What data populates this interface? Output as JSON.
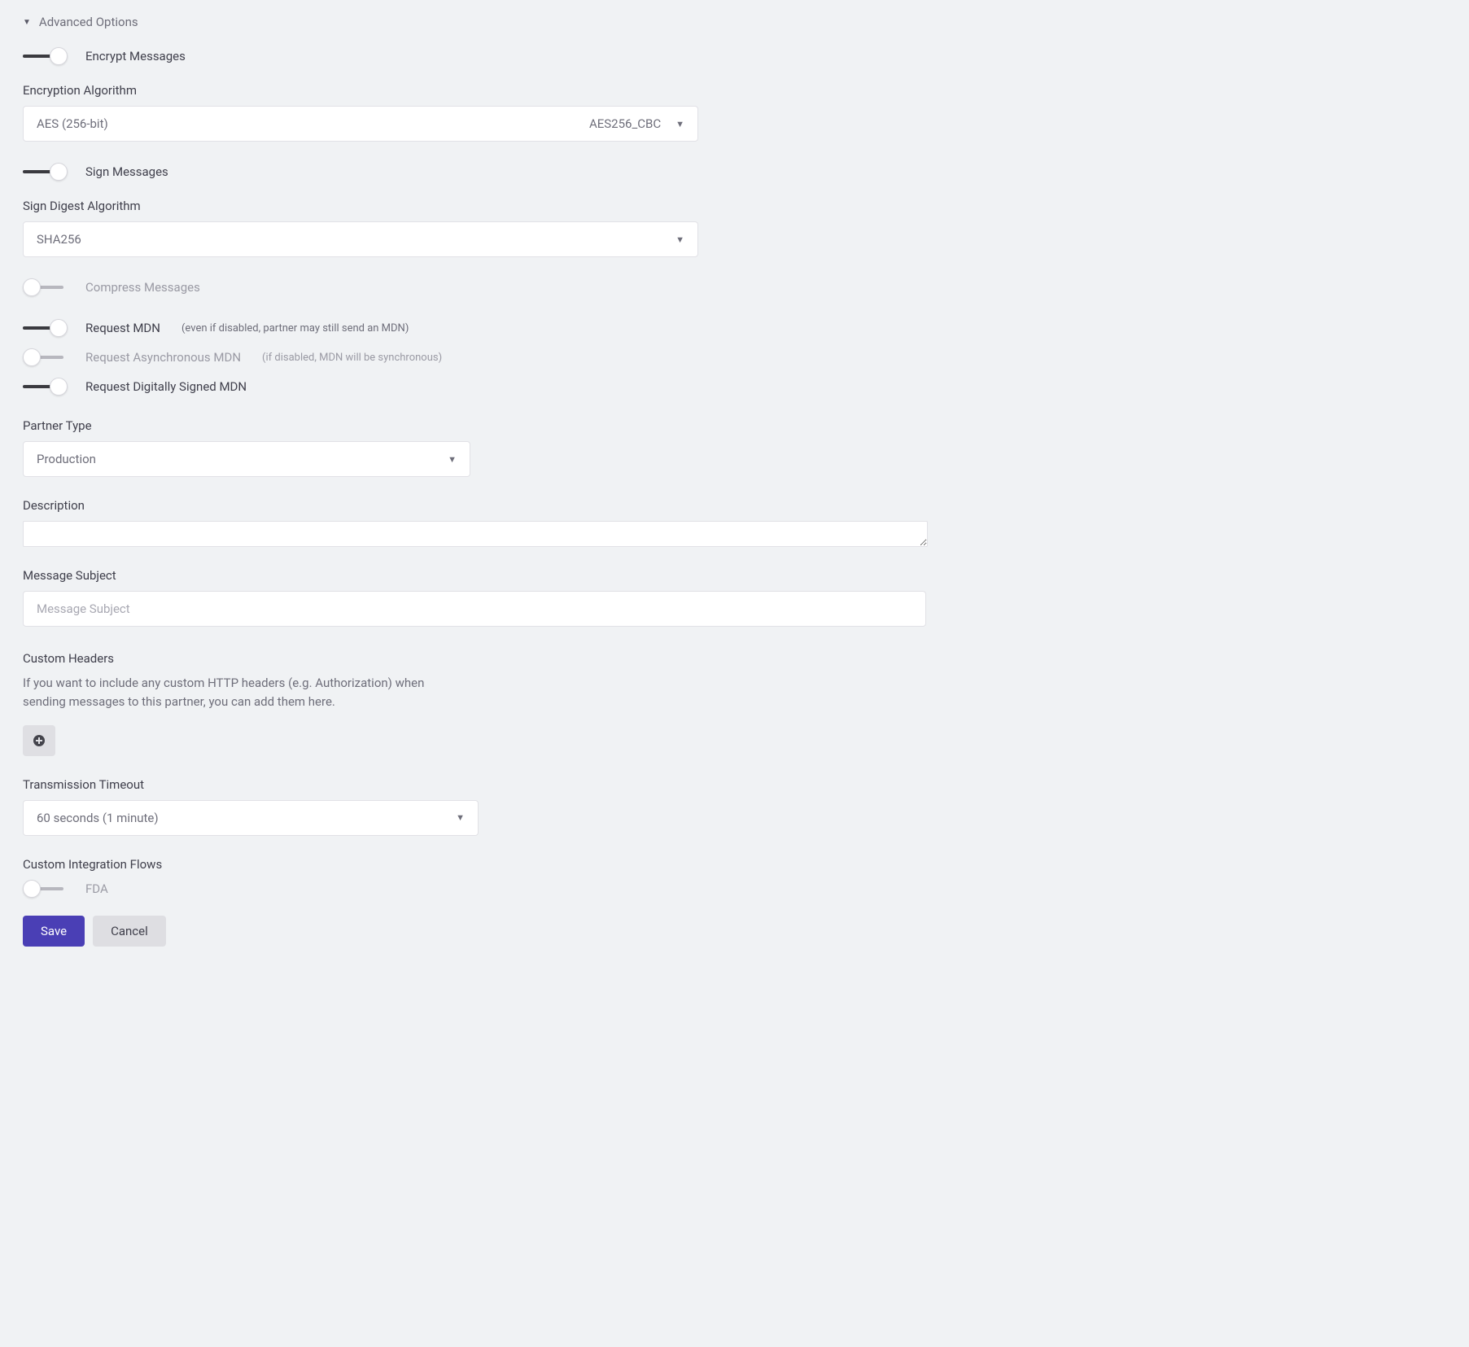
{
  "section": {
    "title": "Advanced Options"
  },
  "toggles": {
    "encrypt": {
      "label": "Encrypt Messages",
      "on": true
    },
    "sign": {
      "label": "Sign Messages",
      "on": true
    },
    "compress": {
      "label": "Compress Messages",
      "on": false
    },
    "mdn": {
      "label": "Request MDN",
      "hint": "(even if disabled, partner may still send an MDN)",
      "on": true
    },
    "async_mdn": {
      "label": "Request Asynchronous MDN",
      "hint": "(if disabled, MDN will be synchronous)",
      "on": false
    },
    "signed_mdn": {
      "label": "Request Digitally Signed MDN",
      "on": true
    },
    "fda": {
      "label": "FDA",
      "on": false
    }
  },
  "fields": {
    "encryption_algo": {
      "label": "Encryption Algorithm",
      "value": "AES (256-bit)",
      "code": "AES256_CBC"
    },
    "sign_digest": {
      "label": "Sign Digest Algorithm",
      "value": "SHA256"
    },
    "partner_type": {
      "label": "Partner Type",
      "value": "Production"
    },
    "description": {
      "label": "Description",
      "value": ""
    },
    "message_subject": {
      "label": "Message Subject",
      "placeholder": "Message Subject",
      "value": ""
    },
    "custom_headers": {
      "label": "Custom Headers",
      "help": "If you want to include any custom HTTP headers (e.g. Authorization) when sending messages to this partner, you can add them here."
    },
    "timeout": {
      "label": "Transmission Timeout",
      "value": "60 seconds (1 minute)"
    },
    "custom_flows": {
      "label": "Custom Integration Flows"
    }
  },
  "buttons": {
    "save": "Save",
    "cancel": "Cancel"
  }
}
